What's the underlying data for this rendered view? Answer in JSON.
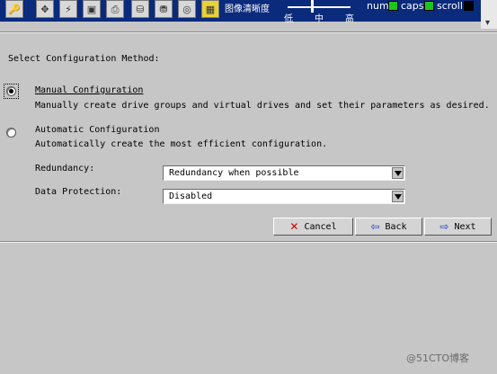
{
  "toolbar": {
    "icons": [
      "key-icon",
      "move-icon",
      "lightning-icon",
      "monitor-icon",
      "scanner-icon",
      "disk-icon",
      "drive-icon",
      "disc-icon",
      "grid-icon"
    ],
    "quality_label": "图像清晰度",
    "quality_low": "低",
    "quality_mid": "中",
    "quality_high": "高",
    "num_label": "num",
    "caps_label": "caps",
    "scroll_label": "scroll",
    "num_color": "#1ec41e",
    "caps_color": "#1ec41e",
    "scroll_color": "#000000"
  },
  "main": {
    "heading": "Select Configuration Method:",
    "manual": {
      "label": "Manual Configuration",
      "desc": "Manually create drive groups and virtual drives and set their parameters as desired.",
      "selected": true
    },
    "automatic": {
      "label": "Automatic Configuration",
      "desc": "Automatically create the most efficient configuration.",
      "selected": false
    },
    "redundancy": {
      "label": "Redundancy:",
      "value": "Redundancy when possible"
    },
    "data_protection": {
      "label": "Data Protection:",
      "value": "Disabled"
    }
  },
  "buttons": {
    "cancel": "Cancel",
    "back": "Back",
    "next": "Next"
  },
  "watermark": "@51CTO博客"
}
